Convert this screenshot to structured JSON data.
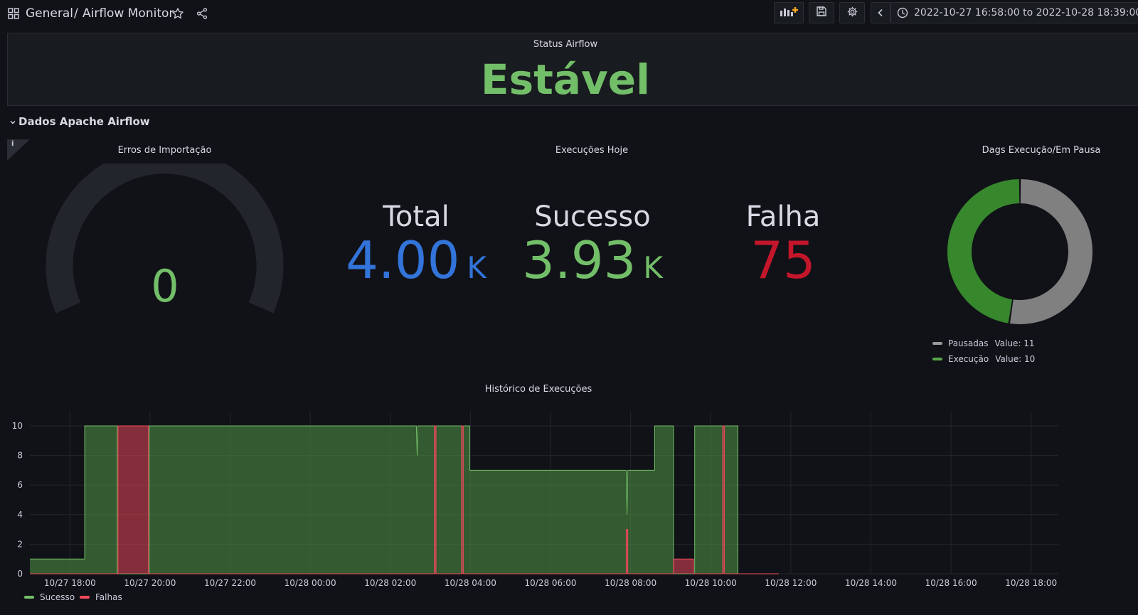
{
  "topbar": {
    "folder": "General",
    "separator": "/",
    "dashboard": "Airflow Monitor",
    "time_range": "2022-10-27 16:58:00 to 2022-10-28 18:39:00"
  },
  "status_panel": {
    "title": "Status Airflow",
    "value": "Estável",
    "value_color": "#73bf69"
  },
  "row": {
    "title": "Dados Apache Airflow"
  },
  "info_badge": "i",
  "gauge_panel": {
    "title": "Erros de Importação",
    "value": "0",
    "value_color": "#73bf69"
  },
  "execucoes_panel": {
    "title": "Execuções Hoje",
    "stats": [
      {
        "label": "Total",
        "value": "4.00",
        "unit": "K",
        "color": "#3274d9"
      },
      {
        "label": "Sucesso",
        "value": "3.93",
        "unit": "K",
        "color": "#73bf69"
      },
      {
        "label": "Falha",
        "value": "75",
        "unit": "",
        "color": "#c4162a"
      }
    ]
  },
  "donut_panel": {
    "title": "Dags Execução/Em Pausa",
    "legend": [
      {
        "label": "Pausadas",
        "value_text": "Value: 11",
        "color": "#808080"
      },
      {
        "label": "Execução",
        "value_text": "Value: 10",
        "color": "#37872d"
      }
    ]
  },
  "chart_data": [
    {
      "type": "pie",
      "title": "Dags Execução/Em Pausa",
      "labels": [
        "Pausadas",
        "Execução"
      ],
      "values": [
        11,
        10
      ],
      "colors": [
        "#808080",
        "#37872d"
      ],
      "donut": true
    },
    {
      "type": "area",
      "title": "Histórico de Execuções",
      "y_ticks": [
        "0",
        "2",
        "4",
        "6",
        "8",
        "10"
      ],
      "ylim": [
        0,
        10
      ],
      "x_ticks": [
        "10/27 18:00",
        "10/27 20:00",
        "10/27 22:00",
        "10/28 00:00",
        "10/28 02:00",
        "10/28 04:00",
        "10/28 06:00",
        "10/28 08:00",
        "10/28 10:00",
        "10/28 12:00",
        "10/28 14:00",
        "10/28 16:00",
        "10/28 18:00"
      ],
      "xlim_hours": [
        -1.0,
        24.68
      ],
      "grid": true,
      "legend_position": "bottom-left",
      "series": [
        {
          "name": "Sucesso",
          "color": "#73bf69",
          "points": [
            [
              -1.0,
              1
            ],
            [
              0.37,
              1
            ],
            [
              0.37,
              10
            ],
            [
              1.18,
              10
            ],
            [
              1.18,
              0
            ],
            [
              1.98,
              0
            ],
            [
              1.98,
              10
            ],
            [
              8.65,
              10
            ],
            [
              8.67,
              8
            ],
            [
              8.69,
              10
            ],
            [
              9.98,
              10
            ],
            [
              9.98,
              7
            ],
            [
              13.89,
              7
            ],
            [
              13.91,
              4
            ],
            [
              13.93,
              7
            ],
            [
              14.6,
              7
            ],
            [
              14.6,
              10
            ],
            [
              15.07,
              10
            ],
            [
              15.07,
              0
            ],
            [
              15.6,
              0
            ],
            [
              15.6,
              10
            ],
            [
              16.68,
              10
            ],
            [
              16.68,
              0
            ],
            [
              17.7,
              0
            ]
          ]
        },
        {
          "name": "Falhas",
          "color": "#f2495c",
          "points": [
            [
              -1.0,
              0
            ],
            [
              1.2,
              0
            ],
            [
              1.2,
              10
            ],
            [
              1.96,
              10
            ],
            [
              1.96,
              0
            ],
            [
              9.1,
              0
            ],
            [
              9.1,
              10
            ],
            [
              9.14,
              10
            ],
            [
              9.14,
              0
            ],
            [
              9.78,
              0
            ],
            [
              9.78,
              10
            ],
            [
              9.82,
              10
            ],
            [
              9.82,
              0
            ],
            [
              13.89,
              0
            ],
            [
              13.89,
              3
            ],
            [
              13.93,
              3
            ],
            [
              13.93,
              0
            ],
            [
              15.07,
              0
            ],
            [
              15.07,
              1
            ],
            [
              15.57,
              1
            ],
            [
              15.57,
              0
            ],
            [
              16.3,
              0
            ],
            [
              16.3,
              10
            ],
            [
              16.34,
              10
            ],
            [
              16.34,
              0
            ],
            [
              17.7,
              0
            ]
          ]
        }
      ]
    }
  ]
}
